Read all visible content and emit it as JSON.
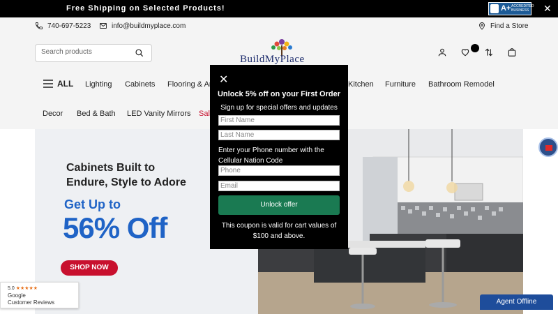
{
  "topbar": {
    "promo": "Free Shipping on Selected Products!",
    "bbb_rating": "A+",
    "bbb_text": "ACCREDITED BUSINESS"
  },
  "contact": {
    "phone": "740-697-5223",
    "email": "info@buildmyplace.com",
    "find_store": "Find a Store"
  },
  "search": {
    "placeholder": "Search products"
  },
  "logo": {
    "text": "BuildMyPlace"
  },
  "nav_primary": {
    "all": "ALL",
    "items": [
      "Lighting",
      "Cabinets",
      "Flooring & Ar",
      "Kitchen",
      "Furniture",
      "Bathroom Remodel"
    ]
  },
  "nav_secondary": {
    "items": [
      "Decor",
      "Bed & Bath",
      "LED Vanity Mirrors",
      "Sale"
    ]
  },
  "hero": {
    "title_line1": "Cabinets Built to",
    "title_line2": "Endure, Style to Adore",
    "get_up": "Get Up to",
    "discount": "56% Off",
    "cta": "SHOP NOW"
  },
  "modal": {
    "title": "Unlock 5% off on your First Order",
    "subtitle": "Sign up for special offers and updates",
    "first_name_placeholder": "First Name",
    "last_name_placeholder": "Last Name",
    "phone_label": "Enter your Phone number with the Cellular Nation Code",
    "phone_placeholder": "Phone",
    "email_placeholder": "Email",
    "button": "Unlock offer",
    "note": "This coupon is valid for cart values of $100 and above."
  },
  "google_reviews": {
    "score": "5.0",
    "stars": "★★★★★",
    "line1": "Google",
    "line2": "Customer Reviews"
  },
  "chat": {
    "label": "Agent Offline"
  },
  "colors": {
    "brand_blue": "#1f63c6",
    "sale_red": "#c8102e",
    "modal_green": "#1a7a52",
    "agent_blue": "#1e4d9b"
  }
}
